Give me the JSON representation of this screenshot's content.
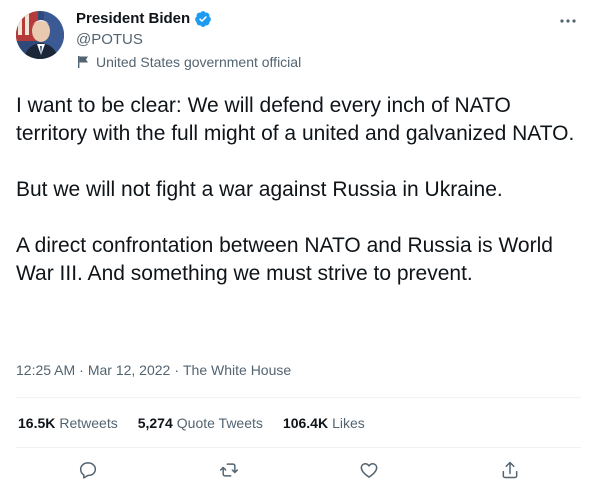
{
  "user": {
    "display_name": "President Biden",
    "handle": "@POTUS",
    "gov_label": "United States government official",
    "verified": true
  },
  "tweet": {
    "paragraphs": [
      "I want to be clear: We will defend every inch of NATO territory with the full might of a united and galvanized NATO.",
      "But we will not fight a war against Russia in Ukraine.",
      "A direct confrontation between NATO and Russia is World War III. And something we must strive to prevent."
    ],
    "time": "12:25 AM",
    "date": "Mar 12, 2022",
    "source": "The White House",
    "separator": "·"
  },
  "stats": {
    "retweets_count": "16.5K",
    "retweets_label": "Retweets",
    "quotes_count": "5,274",
    "quotes_label": "Quote Tweets",
    "likes_count": "106.4K",
    "likes_label": "Likes"
  },
  "colors": {
    "text_primary": "#0f1419",
    "text_secondary": "#536471",
    "verified_blue": "#1d9bf0",
    "divider": "#eff3f4"
  },
  "icons": {
    "verified": "verified-badge-icon",
    "more": "more-options-icon",
    "flag": "government-flag-icon",
    "reply": "reply-icon",
    "retweet": "retweet-icon",
    "like": "like-heart-icon",
    "share": "share-icon"
  }
}
